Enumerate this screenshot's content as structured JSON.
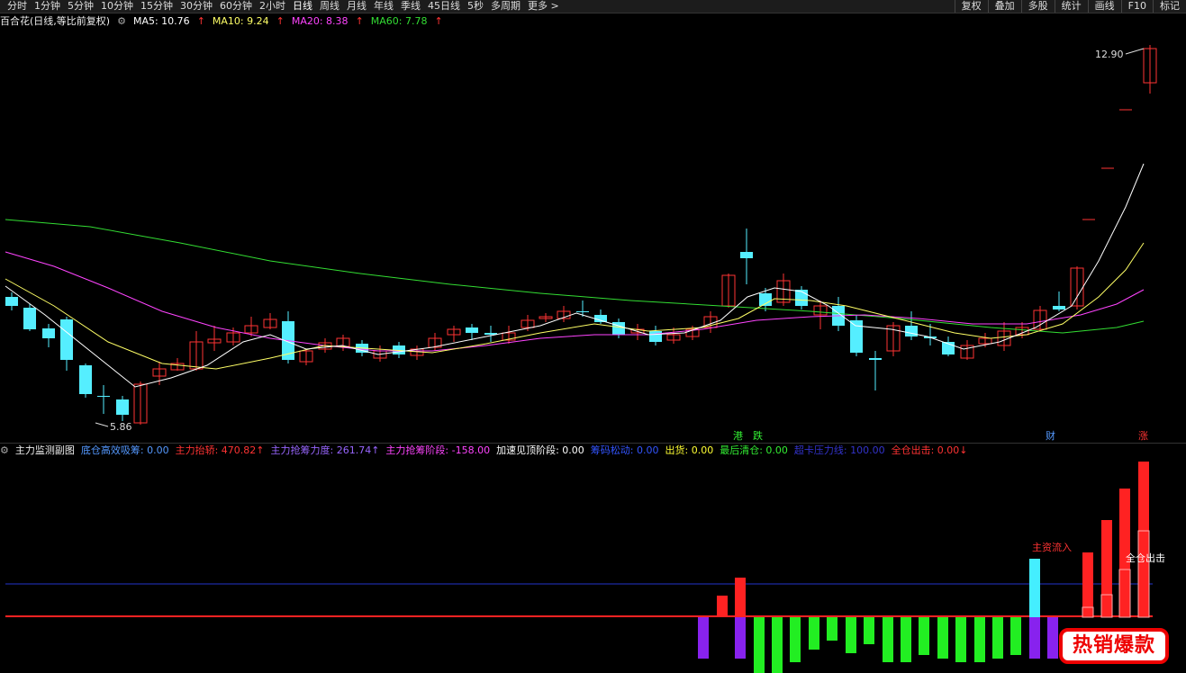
{
  "toolbar": {
    "tabs": [
      "分时",
      "1分钟",
      "5分钟",
      "10分钟",
      "15分钟",
      "30分钟",
      "60分钟",
      "2小时",
      "日线",
      "周线",
      "月线",
      "年线",
      "季线",
      "45日线",
      "5秒",
      "多周期",
      "更多 >"
    ],
    "active_tab": "日线",
    "right_tabs": [
      "复权",
      "叠加",
      "多股",
      "统计",
      "画线",
      "F10",
      "标记"
    ]
  },
  "main_chart": {
    "stock_label": "百合花(日线,等比前复权)",
    "ma_items": [
      {
        "label": "MA5: 10.76",
        "arrow": "↑",
        "color": "#ffffff"
      },
      {
        "label": "MA10: 9.24",
        "arrow": "↑",
        "color": "#ffff66"
      },
      {
        "label": "MA20: 8.38",
        "arrow": "↑",
        "color": "#ff44ff"
      },
      {
        "label": "MA60: 7.78",
        "arrow": "↑",
        "color": "#33dd33"
      }
    ],
    "high_label": "12.90",
    "low_label": "5.86",
    "event_markers": [
      "港",
      "跌",
      "财",
      "涨"
    ]
  },
  "sub_chart": {
    "title": "主力监测副图",
    "items": [
      {
        "label": "底仓高效吸筹: 0.00",
        "color": "#5599ff"
      },
      {
        "label": "主力抬轿: 470.82↑",
        "color": "#ff3333"
      },
      {
        "label": "主力抢筹力度: 261.74↑",
        "color": "#9966ff"
      },
      {
        "label": "主力抢筹阶段: -158.00",
        "color": "#ff44ff"
      },
      {
        "label": "加速见顶阶段: 0.00",
        "color": "#ffffff"
      },
      {
        "label": "筹码松动: 0.00",
        "color": "#3355ff"
      },
      {
        "label": "出货: 0.00",
        "color": "#ffff33"
      },
      {
        "label": "最后清仓: 0.00",
        "color": "#33ee33"
      },
      {
        "label": "超卡压力线: 100.00",
        "color": "#3333cc"
      },
      {
        "label": "全仓出击: 0.00↓",
        "color": "#ff3333"
      }
    ],
    "annotations": {
      "inflow": "主资流入",
      "full_position": "全仓出击"
    }
  },
  "promo": {
    "text": "热销爆款"
  },
  "colors": {
    "up": "#ff3333",
    "down": "#55eeff",
    "ma5": "#ffffff",
    "ma10": "#ffff66",
    "ma20": "#ff44ff",
    "ma60": "#33dd33"
  }
}
